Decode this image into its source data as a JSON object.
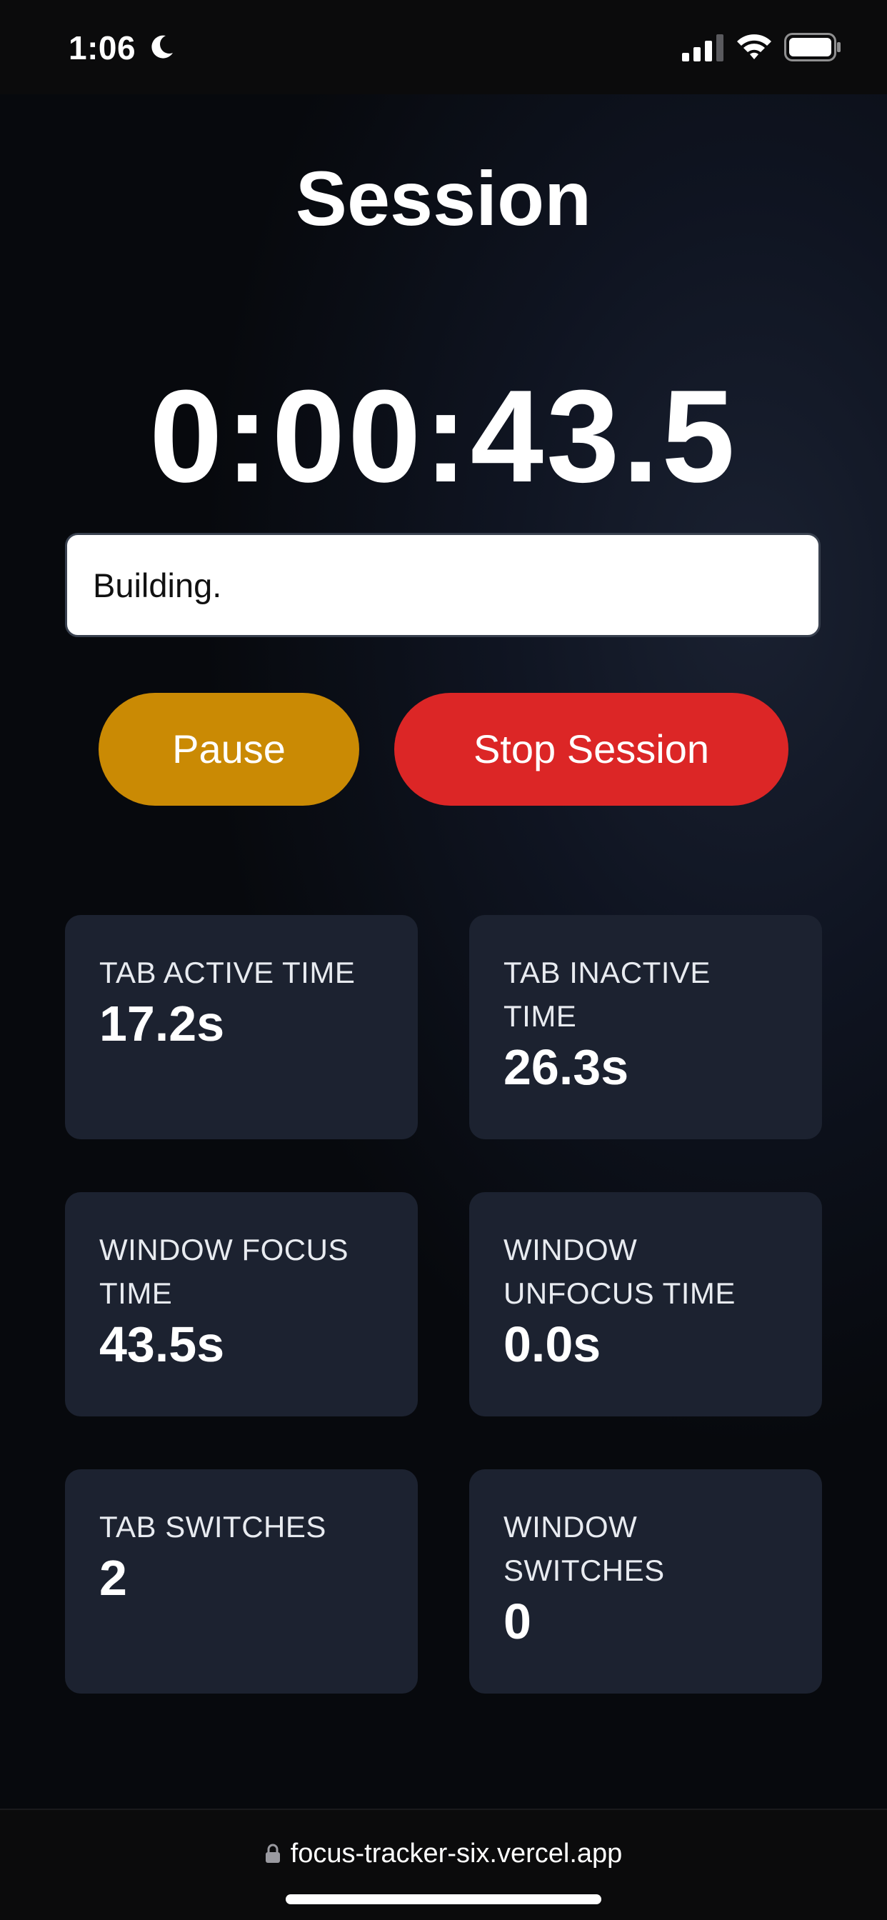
{
  "status_bar": {
    "time": "1:06",
    "icons": [
      "moon-icon",
      "signal-icon",
      "wifi-icon",
      "battery-icon"
    ]
  },
  "page": {
    "title": "Session",
    "timer": "0:00:43.5"
  },
  "note_input": {
    "value": "Building."
  },
  "buttons": {
    "pause_label": "Pause",
    "stop_label": "Stop Session"
  },
  "stats": [
    {
      "label": "TAB ACTIVE TIME",
      "value": "17.2s"
    },
    {
      "label": "TAB INACTIVE TIME",
      "value": "26.3s"
    },
    {
      "label": "WINDOW FOCUS TIME",
      "value": "43.5s"
    },
    {
      "label": "WINDOW UNFOCUS TIME",
      "value": "0.0s"
    },
    {
      "label": "TAB SWITCHES",
      "value": "2"
    },
    {
      "label": "WINDOW SWITCHES",
      "value": "0"
    }
  ],
  "browser": {
    "url": "focus-tracker-six.vercel.app"
  },
  "colors": {
    "pause": "#ca8a04",
    "stop": "#dc2626",
    "card": "#1c2230",
    "background": "#07090d"
  }
}
